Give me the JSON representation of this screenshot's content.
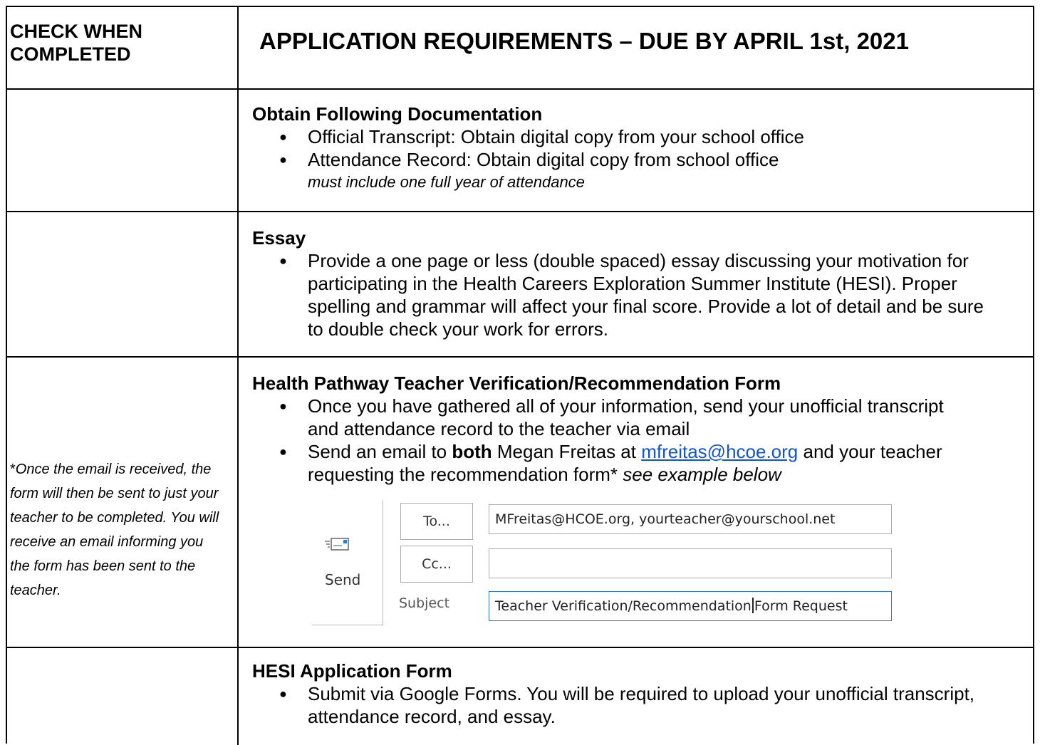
{
  "header": {
    "left": "CHECK  WHEN COMPLETED",
    "right": "APPLICATION REQUIREMENTS – DUE BY APRIL 1st, 2021"
  },
  "sections": {
    "documentation": {
      "title": "Obtain Following Documentation",
      "items": [
        "Official Transcript: Obtain digital copy from your school office",
        "Attendance Record:  Obtain digital copy from school office"
      ],
      "note": "must include one full year of attendance"
    },
    "essay": {
      "title": "Essay",
      "items": [
        "Provide a one page or less (double spaced) essay discussing your motivation for participating in the Health Careers Exploration Summer Institute (HESI).  Proper spelling and grammar will affect your final score.  Provide a lot of detail and be sure to double check your work for errors."
      ]
    },
    "teacher_form": {
      "title": "Health Pathway Teacher Verification/Recommendation Form",
      "item1": "Once you have gathered all of your information, send your unofficial transcript and attendance record to the teacher via email",
      "item2": {
        "pre": "Send an email to ",
        "bold": "both",
        "mid": " Megan Freitas at ",
        "link": "mfreitas@hcoe.org",
        "post": " and your teacher requesting the recommendation form*",
        "italic": " see example below"
      },
      "side_note_star": "*",
      "side_note": "Once the email is received, the form will then be sent to just your teacher to be completed.  You will receive an email informing you the form has been sent to the teacher."
    },
    "hesi_form": {
      "title": "HESI Application Form",
      "items": [
        "Submit via Google Forms.  You will be required to upload your unofficial transcript, attendance record, and essay."
      ]
    }
  },
  "composer": {
    "send_label": "Send",
    "to_label": "To...",
    "cc_label": "Cc...",
    "subject_label": "Subject",
    "to_value": "MFreitas@HCOE.org, yourteacher@yourschool.net",
    "cc_value": "",
    "subject_value_a": "Teacher Verification/Recommendation",
    "subject_value_b": "Form Request"
  },
  "bullet_glyph": "●"
}
